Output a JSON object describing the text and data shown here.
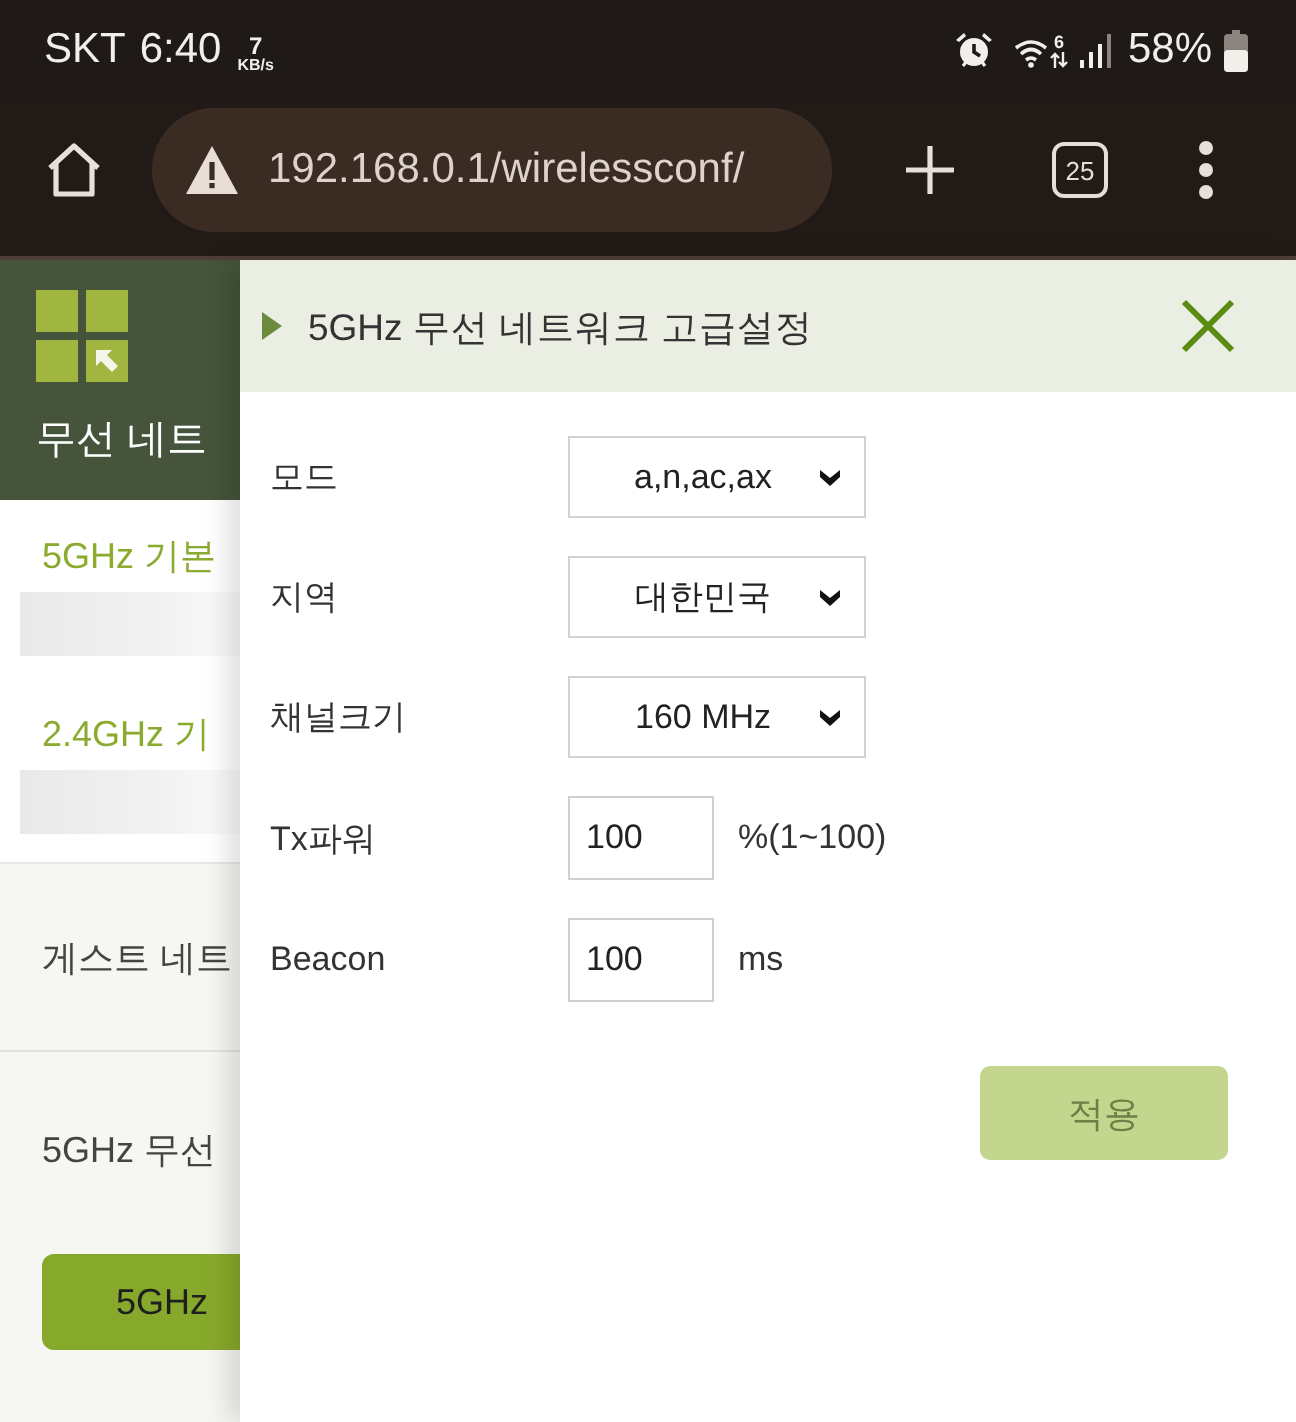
{
  "status_bar": {
    "carrier": "SKT",
    "time": "6:40",
    "speed_value": "7",
    "speed_unit": "KB/s",
    "wifi_badge": "6",
    "battery": "58%"
  },
  "browser_bar": {
    "secure": false,
    "url": "192.168.0.1/wirelessconf/",
    "tab_count": "25"
  },
  "background_page": {
    "title": "무선 네트",
    "basic_links": [
      {
        "label": "5GHz 기본"
      },
      {
        "label": "2.4GHz 기"
      }
    ],
    "sections": [
      {
        "title": "게스트 네트"
      },
      {
        "title": "5GHz 무선",
        "button": "5GHz"
      }
    ]
  },
  "dialog": {
    "title": "5GHz 무선 네트워크 고급설정",
    "fields": [
      {
        "kind": "select",
        "label": "모드",
        "value": "a,n,ac,ax"
      },
      {
        "kind": "select",
        "label": "지역",
        "value": "대한민국"
      },
      {
        "kind": "select",
        "label": "채널크기",
        "value": "160 MHz"
      },
      {
        "kind": "input",
        "label": "Tx파워",
        "value": "100",
        "unit": "%(1~100)"
      },
      {
        "kind": "input",
        "label": "Beacon",
        "value": "100",
        "unit": "ms"
      }
    ],
    "apply_button": {
      "label": "적용",
      "disabled": true
    }
  }
}
